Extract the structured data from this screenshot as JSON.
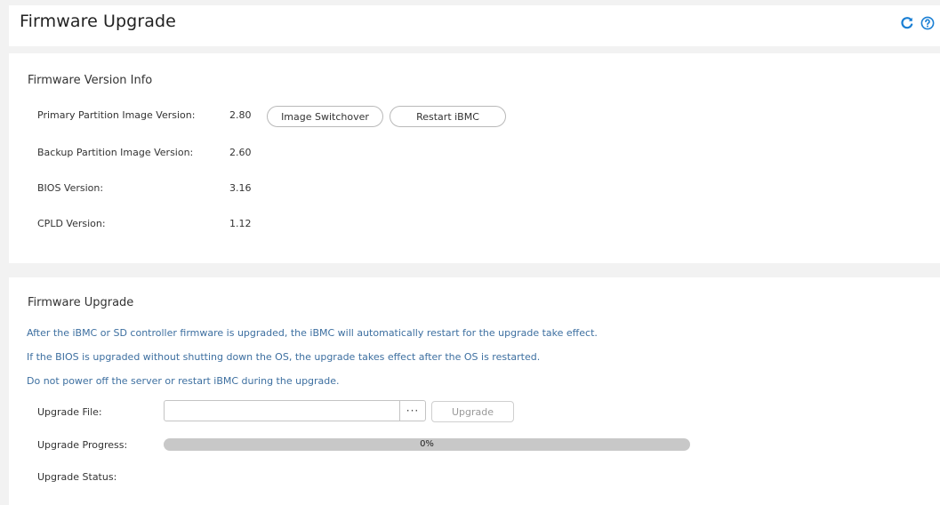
{
  "header": {
    "title": "Firmware Upgrade",
    "refresh_icon": "refresh-icon",
    "help_icon": "help-icon",
    "accent_color": "#1a7fd4"
  },
  "version_info": {
    "title": "Firmware Version Info",
    "rows": [
      {
        "label": "Primary Partition Image Version:",
        "value": "2.80"
      },
      {
        "label": "Backup Partition Image Version:",
        "value": "2.60"
      },
      {
        "label": "BIOS Version:",
        "value": "3.16"
      },
      {
        "label": "CPLD Version:",
        "value": "1.12"
      }
    ],
    "image_switchover_label": "Image Switchover",
    "restart_ibmc_label": "Restart iBMC"
  },
  "upgrade": {
    "title": "Firmware Upgrade",
    "notices": [
      "After the iBMC or SD controller firmware is upgraded, the iBMC will automatically restart for the upgrade take effect.",
      "If the BIOS is upgraded without shutting down the OS, the upgrade takes effect after the OS is restarted.",
      "Do not power off the server or restart iBMC during the upgrade."
    ],
    "file_label": "Upgrade File:",
    "file_value": "",
    "browse_label": "···",
    "upgrade_button_label": "Upgrade",
    "progress_label": "Upgrade Progress:",
    "progress_value": 0,
    "progress_text": "0%",
    "status_label": "Upgrade Status:",
    "status_value": ""
  }
}
